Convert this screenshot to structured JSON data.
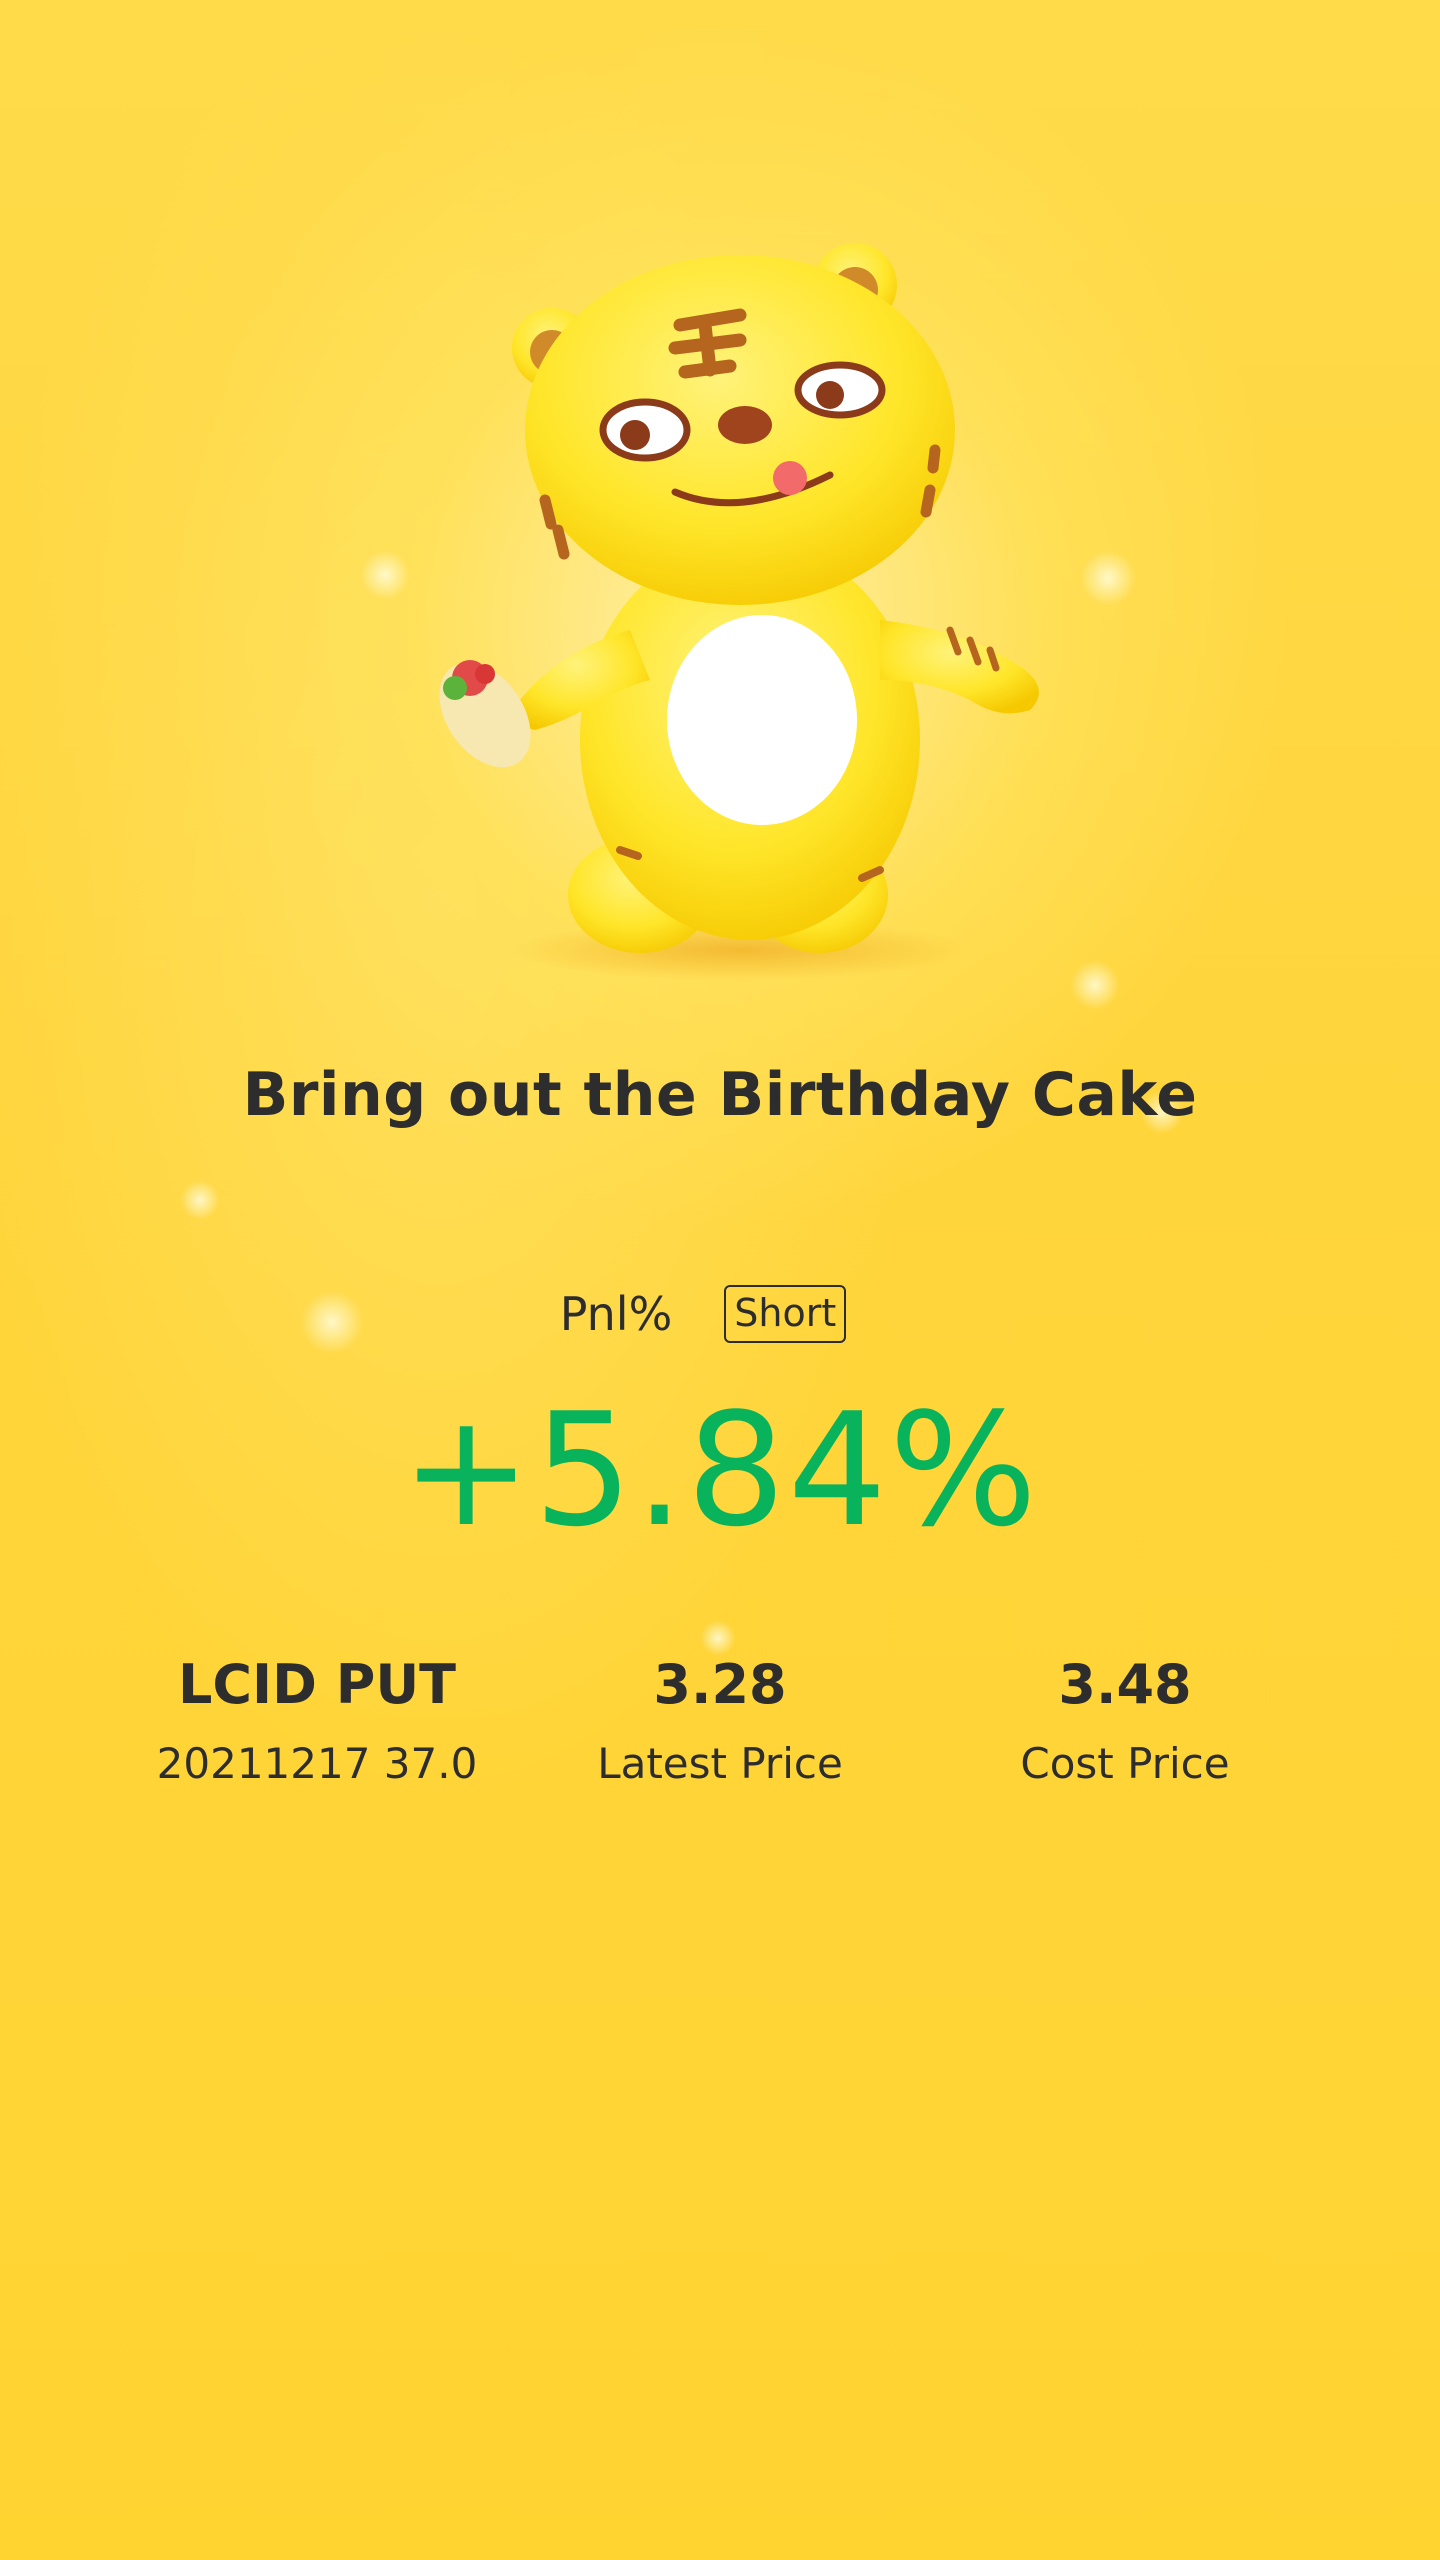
{
  "card": {
    "title": "Bring out the Birthday Cake",
    "mascot_icon": "tiger-mascot-icon",
    "pnl_label": "Pnl%",
    "direction_badge": "Short",
    "pnl_value": "+5.84%",
    "pnl_color": "#09b35c",
    "background_color": "#ffd93a"
  },
  "stats": [
    {
      "top": "LCID PUT",
      "bottom": "20211217 37.0"
    },
    {
      "top": "3.28",
      "bottom": "Latest Price"
    },
    {
      "top": "3.48",
      "bottom": "Cost Price"
    }
  ]
}
